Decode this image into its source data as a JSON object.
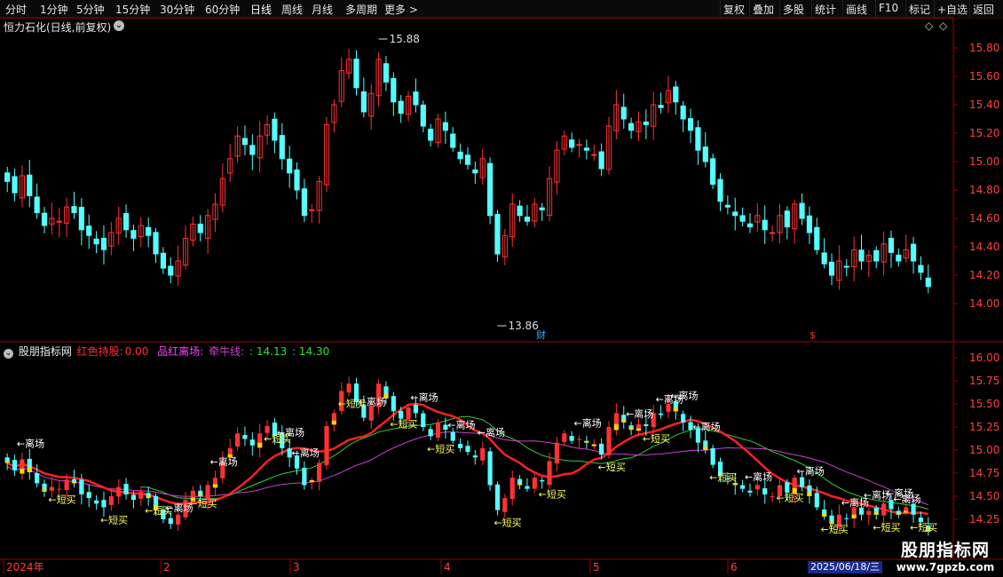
{
  "toolbar": {
    "left": [
      "分时",
      "1分钟",
      "5分钟",
      "15分钟",
      "30分钟",
      "60分钟",
      "日线",
      "周线",
      "月线",
      "多周期",
      "更多 >"
    ],
    "right": [
      "复权",
      "叠加",
      "多股",
      "统计",
      "画线",
      "F10",
      "标记",
      "+自选",
      "返回"
    ],
    "active": "日线"
  },
  "main_chart": {
    "title": "恒力石化(日线,前复权)",
    "high_label": "15.88",
    "low_label": "13.86",
    "markers": [
      "财",
      "$"
    ],
    "y_ticks": [
      "15.80",
      "15.60",
      "15.40",
      "15.20",
      "15.00",
      "14.80",
      "14.60",
      "14.40",
      "14.20",
      "14.00"
    ]
  },
  "indicator": {
    "name": "股朋指标网",
    "red_hold_label": "红色持股:",
    "red_hold_value": "0.00",
    "exit_label": "品红离场:",
    "bull_label": "牵牛线:",
    "bull_value1": ": 14.13",
    "bull_value2": ": 14.30",
    "y_ticks": [
      "16.00",
      "15.75",
      "15.50",
      "15.25",
      "15.00",
      "14.75",
      "14.50",
      "14.25"
    ],
    "sell_tag": "←离场",
    "buy_tag": "←短买"
  },
  "time_axis": {
    "labels": [
      "2024年",
      "2",
      "3",
      "4",
      "5",
      "6"
    ],
    "cursor_date": "2025/06/18/三"
  },
  "watermark": {
    "line1": "股朋指标网",
    "line2": "www.7gpzb.com"
  },
  "colors": {
    "up": "#ff3232",
    "down": "#54ffff",
    "bull_line": "#ff2020",
    "green_line": "#30d030",
    "magenta_line": "#d040d0",
    "axis": "#a00000"
  },
  "chart_data": {
    "type": "candlestick",
    "closes": [
      14.86,
      14.78,
      14.9,
      14.76,
      14.64,
      14.55,
      14.6,
      14.58,
      14.68,
      14.64,
      14.52,
      14.48,
      14.42,
      14.38,
      14.5,
      14.6,
      14.52,
      14.46,
      14.55,
      14.48,
      14.35,
      14.25,
      14.2,
      14.3,
      14.46,
      14.56,
      14.5,
      14.62,
      14.7,
      14.88,
      15.02,
      15.18,
      15.12,
      15.05,
      15.18,
      15.26,
      15.15,
      15.02,
      14.92,
      14.8,
      14.62,
      14.66,
      14.86,
      15.26,
      15.4,
      15.64,
      15.72,
      15.52,
      15.35,
      15.48,
      15.72,
      15.56,
      15.42,
      15.34,
      15.46,
      15.4,
      15.25,
      15.15,
      15.3,
      15.22,
      15.1,
      15.02,
      14.98,
      14.92,
      15.02,
      14.62,
      14.35,
      14.48,
      14.7,
      14.62,
      14.58,
      14.7,
      14.66,
      14.88,
      15.08,
      15.18,
      15.1,
      15.12,
      15.08,
      15.05,
      14.95,
      15.25,
      15.4,
      15.3,
      15.22,
      15.28,
      15.26,
      15.4,
      15.38,
      15.5,
      15.42,
      15.3,
      15.22,
      15.08,
      15.0,
      14.84,
      14.72,
      14.68,
      14.62,
      14.58,
      14.54,
      14.62,
      14.52,
      14.5,
      14.62,
      14.54,
      14.7,
      14.6,
      14.5,
      14.38,
      14.28,
      14.2,
      14.3,
      14.26,
      14.38,
      14.3,
      14.34,
      14.3,
      14.42,
      14.36,
      14.3,
      14.38,
      14.3,
      14.22,
      14.12
    ],
    "high": "15.88",
    "low": "13.86",
    "series_lines": [
      "bull_line",
      "green_line",
      "magenta_line"
    ]
  }
}
